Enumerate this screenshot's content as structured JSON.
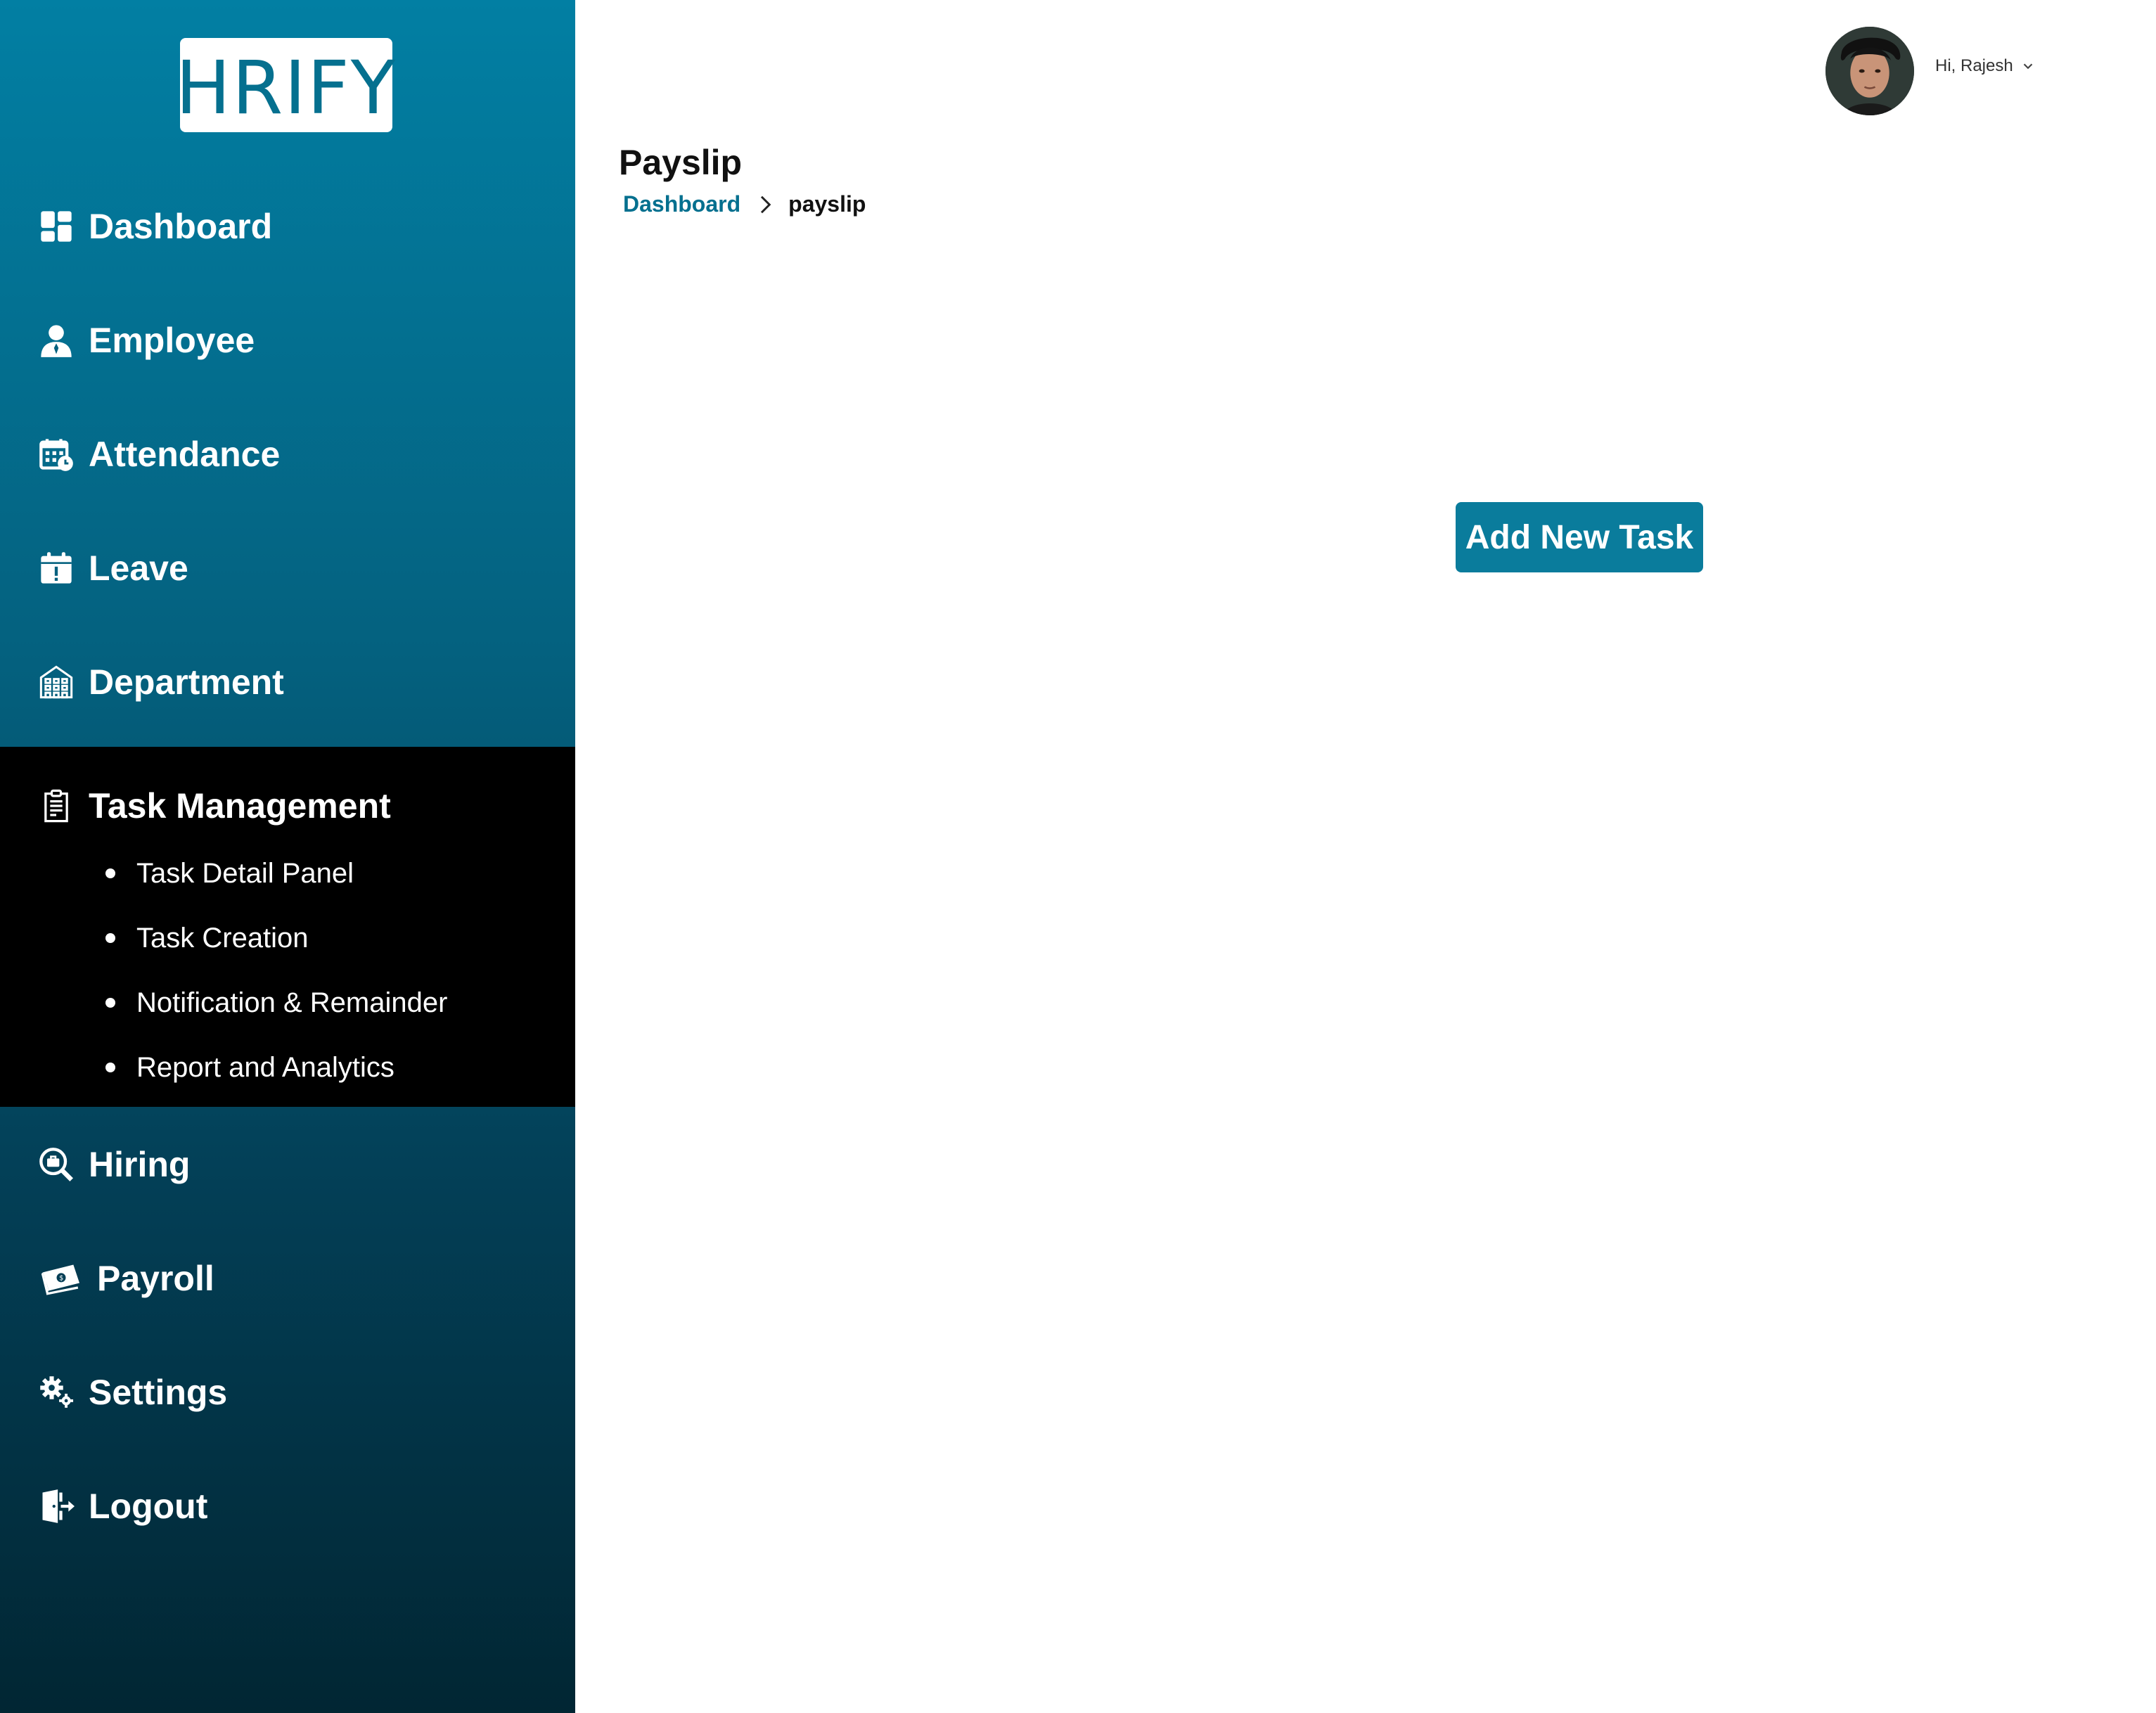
{
  "brand": {
    "logo_text": "HRIFY",
    "accent_color": "#0a7c9c"
  },
  "sidebar": {
    "items": [
      {
        "label": "Dashboard",
        "icon": "dashboard-icon"
      },
      {
        "label": "Employee",
        "icon": "person-icon"
      },
      {
        "label": "Attendance",
        "icon": "calendar-clock-icon"
      },
      {
        "label": "Leave",
        "icon": "calendar-alert-icon"
      },
      {
        "label": "Department",
        "icon": "building-icon"
      },
      {
        "label": "Task Management",
        "icon": "clipboard-icon",
        "active": true,
        "subitems": [
          {
            "label": "Task Detail Panel"
          },
          {
            "label": "Task Creation"
          },
          {
            "label": "Notification & Remainder"
          },
          {
            "label": "Report and Analytics"
          }
        ]
      },
      {
        "label": "Hiring",
        "icon": "search-briefcase-icon"
      },
      {
        "label": "Payroll",
        "icon": "money-icon"
      },
      {
        "label": "Settings",
        "icon": "gears-icon"
      },
      {
        "label": "Logout",
        "icon": "logout-door-icon"
      }
    ]
  },
  "header": {
    "greeting": "Hi, Rajesh",
    "avatar": "user-avatar"
  },
  "page": {
    "title": "Payslip",
    "breadcrumb": {
      "parent": "Dashboard",
      "current": "payslip"
    }
  },
  "main": {
    "add_task_label": "Add New Task"
  }
}
